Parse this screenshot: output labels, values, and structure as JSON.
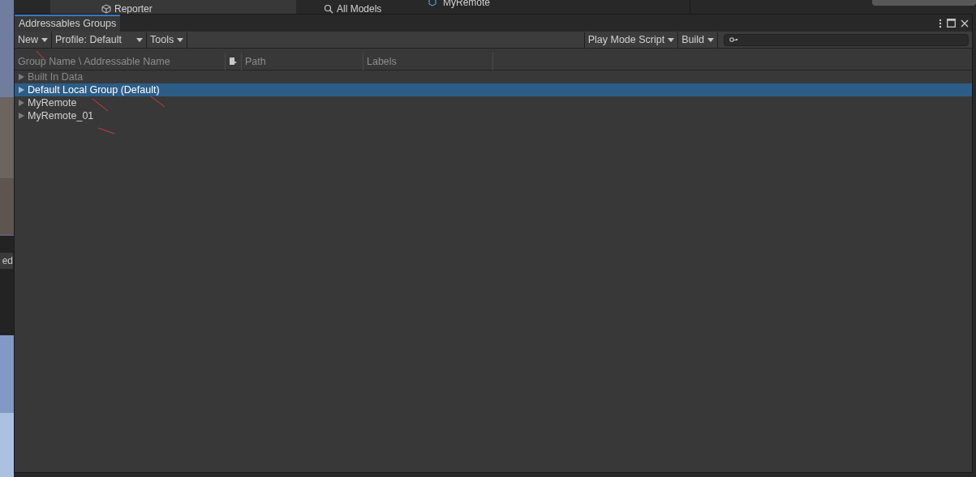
{
  "background": {
    "items": [
      {
        "label": "Reporter"
      },
      {
        "label": "All Models"
      },
      {
        "label": "MyRemote"
      }
    ],
    "left_panel_text": "ed"
  },
  "window": {
    "tab": "Addressables Groups"
  },
  "toolbar": {
    "left": [
      {
        "label": "New"
      },
      {
        "label": "Profile: Default"
      },
      {
        "label": "Tools"
      }
    ],
    "right": [
      {
        "label": "Play Mode Script"
      },
      {
        "label": "Build"
      }
    ]
  },
  "columns": [
    "Group Name \\ Addressable Name",
    "Path",
    "Labels"
  ],
  "groups": [
    {
      "name": "Built In Data",
      "selected": false,
      "disabled": true
    },
    {
      "name": "Default Local Group (Default)",
      "selected": true,
      "disabled": false
    },
    {
      "name": "MyRemote",
      "selected": false,
      "disabled": false
    },
    {
      "name": "MyRemote_01",
      "selected": false,
      "disabled": false
    }
  ]
}
